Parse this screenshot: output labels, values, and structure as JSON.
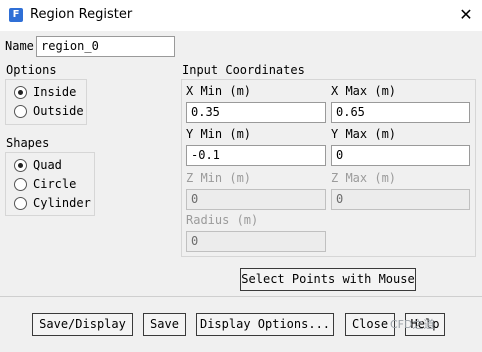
{
  "window": {
    "icon_glyph": "F",
    "title": "Region Register",
    "close_glyph": "✕"
  },
  "name": {
    "label": "Name",
    "value": "region_0"
  },
  "options": {
    "heading": "Options",
    "items": [
      {
        "label": "Inside",
        "selected": true
      },
      {
        "label": "Outside",
        "selected": false
      }
    ]
  },
  "shapes": {
    "heading": "Shapes",
    "items": [
      {
        "label": "Quad",
        "selected": true
      },
      {
        "label": "Circle",
        "selected": false
      },
      {
        "label": "Cylinder",
        "selected": false
      }
    ]
  },
  "coords": {
    "heading": "Input Coordinates",
    "x_min": {
      "label": "X Min (m)",
      "value": "0.35"
    },
    "x_max": {
      "label": "X Max (m)",
      "value": "0.65"
    },
    "y_min": {
      "label": "Y Min (m)",
      "value": "-0.1"
    },
    "y_max": {
      "label": "Y Max (m)",
      "value": "0"
    },
    "z_min": {
      "label": "Z Min (m)",
      "value": "0"
    },
    "z_max": {
      "label": "Z Max (m)",
      "value": "0"
    },
    "radius": {
      "label": "Radius (m)",
      "value": "0"
    }
  },
  "select_points_label": "Select Points with Mouse",
  "buttons": {
    "save_display": "Save/Display",
    "save": "Save",
    "display_options": "Display Options...",
    "close": "Close",
    "help": "Help"
  },
  "watermark": "CFD之道"
}
